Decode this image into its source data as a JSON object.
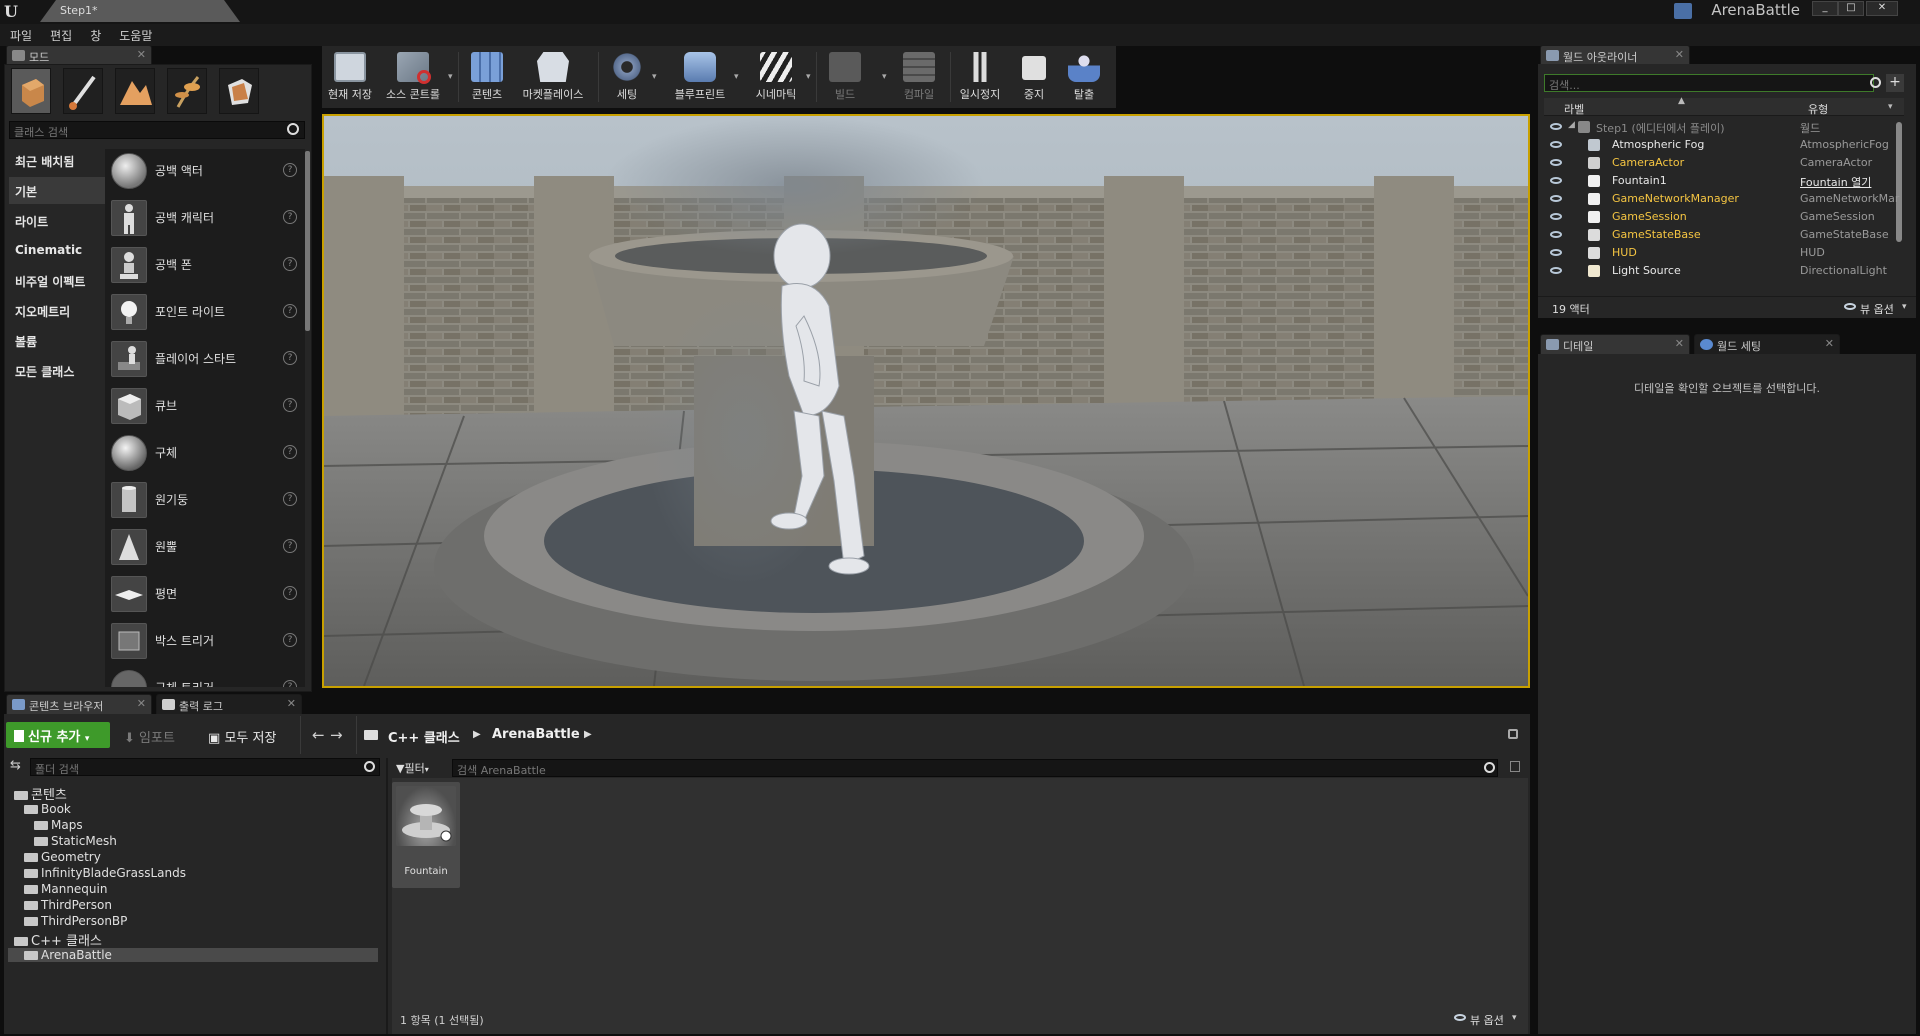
{
  "window": {
    "doc_tab": "Step1*",
    "project_name": "ArenaBattle"
  },
  "menu": [
    "파일",
    "편집",
    "창",
    "도움말"
  ],
  "modes": {
    "tab_label": "모드",
    "search_placeholder": "클래스 검색",
    "categories": [
      "최근 배치됨",
      "기본",
      "라이트",
      "Cinematic",
      "비주얼 이펙트",
      "지오메트리",
      "볼륨",
      "모든 클래스"
    ],
    "selected_category": "기본",
    "items": [
      "공백 액터",
      "공백 캐릭터",
      "공백 폰",
      "포인트 라이트",
      "플레이어 스타트",
      "큐브",
      "구체",
      "원기둥",
      "원뿔",
      "평면",
      "박스 트리거",
      "구체 트리거"
    ]
  },
  "toolbar": {
    "buttons": [
      {
        "label": "현재 저장",
        "enabled": true
      },
      {
        "label": "소스 콘트롤",
        "enabled": true
      },
      {
        "label": "콘텐츠",
        "enabled": true
      },
      {
        "label": "마켓플레이스",
        "enabled": true
      },
      {
        "label": "세팅",
        "enabled": true
      },
      {
        "label": "블루프린트",
        "enabled": true
      },
      {
        "label": "시네마틱",
        "enabled": true
      },
      {
        "label": "빌드",
        "enabled": false
      },
      {
        "label": "컴파일",
        "enabled": false
      },
      {
        "label": "일시정지",
        "enabled": true
      },
      {
        "label": "중지",
        "enabled": true
      },
      {
        "label": "탈출",
        "enabled": true
      }
    ]
  },
  "outliner": {
    "tab_label": "월드 아웃라이너",
    "search_placeholder": "검색...",
    "col_label": "라벨",
    "col_type": "유형",
    "root": {
      "label": "Step1 (에디터에서 플레이)",
      "type": "월드"
    },
    "rows": [
      {
        "label": "Atmospheric Fog",
        "type": "AtmosphericFog",
        "label_color": "#e8e8e8"
      },
      {
        "label": "CameraActor",
        "type": "CameraActor",
        "label_color": "#f5c542"
      },
      {
        "label": "Fountain1",
        "type": "Fountain 열기",
        "label_color": "#e8e8e8"
      },
      {
        "label": "GameNetworkManager",
        "type": "GameNetworkMar",
        "label_color": "#f5c542"
      },
      {
        "label": "GameSession",
        "type": "GameSession",
        "label_color": "#f5c542"
      },
      {
        "label": "GameStateBase",
        "type": "GameStateBase",
        "label_color": "#f5c542"
      },
      {
        "label": "HUD",
        "type": "HUD",
        "label_color": "#f5c542"
      },
      {
        "label": "Light Source",
        "type": "DirectionalLight",
        "label_color": "#e8e8e8"
      }
    ],
    "actor_count": "19 액터",
    "view_options": "뷰 옵션"
  },
  "details": {
    "tab_details": "디테일",
    "tab_world": "월드 세팅",
    "empty_message": "디테일을 확인할 오브젝트를 선택합니다."
  },
  "content_browser": {
    "tab_label": "콘텐츠 브라우저",
    "tab_output": "출력 로그",
    "add_new": "신규 추가",
    "import": "임포트",
    "save_all": "모두 저장",
    "breadcrumb": [
      "C++ 클래스",
      "ArenaBattle"
    ],
    "folder_search_placeholder": "폴더 검색",
    "filter_label": "필터",
    "asset_search_placeholder": "검색 ArenaBattle",
    "tree": [
      {
        "label": "콘텐츠",
        "depth": 0,
        "big": true
      },
      {
        "label": "Book",
        "depth": 1
      },
      {
        "label": "Maps",
        "depth": 2
      },
      {
        "label": "StaticMesh",
        "depth": 2
      },
      {
        "label": "Geometry",
        "depth": 1
      },
      {
        "label": "InfinityBladeGrassLands",
        "depth": 1
      },
      {
        "label": "Mannequin",
        "depth": 1
      },
      {
        "label": "ThirdPerson",
        "depth": 1
      },
      {
        "label": "ThirdPersonBP",
        "depth": 1
      },
      {
        "label": "C++ 클래스",
        "depth": 0,
        "big": true
      },
      {
        "label": "ArenaBattle",
        "depth": 1,
        "selected": true
      }
    ],
    "asset": {
      "label": "Fountain"
    },
    "status": "1 항목 (1 선택됨)",
    "view_options": "뷰 옵션"
  },
  "colors": {
    "accent_green": "#3e9a2a",
    "viewport_border": "#c8a000",
    "panel": "#262626"
  }
}
